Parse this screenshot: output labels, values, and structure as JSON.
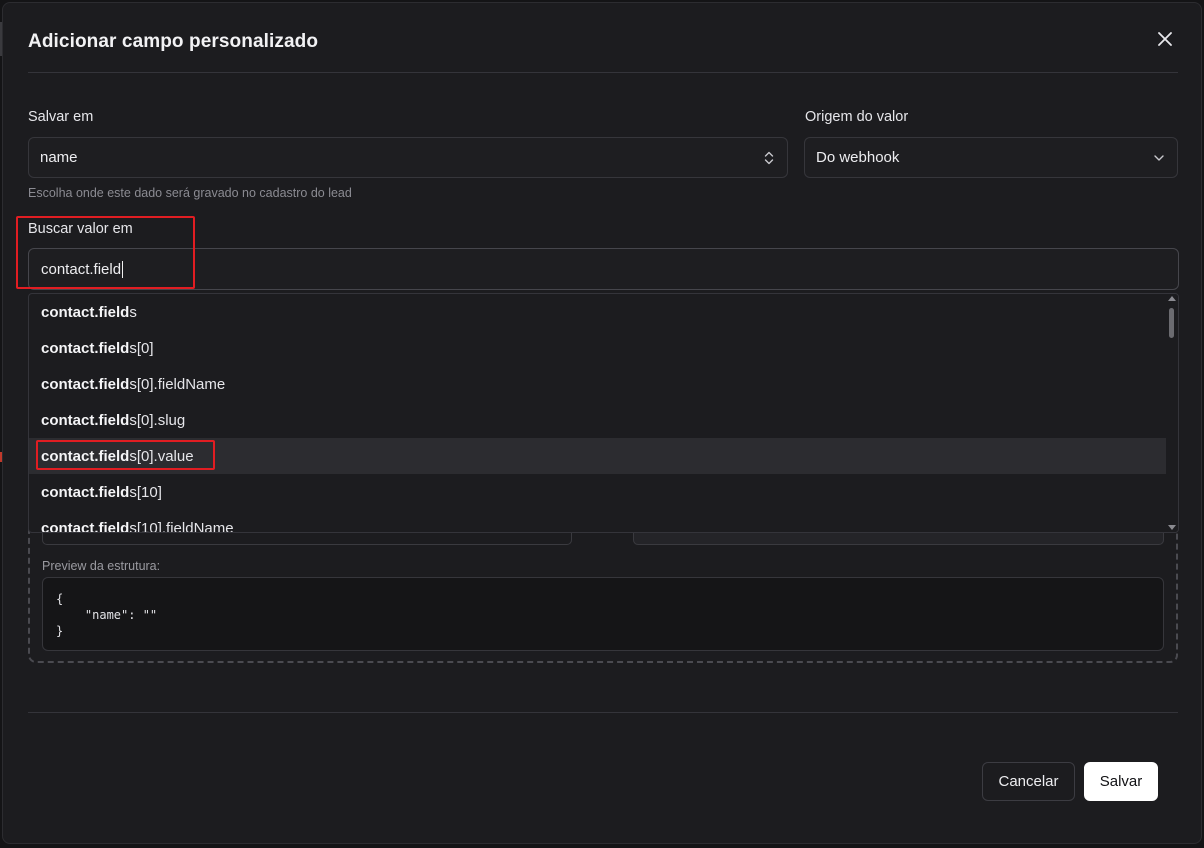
{
  "dialog": {
    "title": "Adicionar campo personalizado"
  },
  "form": {
    "save_in": {
      "label": "Salvar em",
      "value": "name",
      "hint": "Escolha onde este dado será gravado no cadastro do lead"
    },
    "value_origin": {
      "label": "Origem do valor",
      "value": "Do webhook"
    },
    "search_value": {
      "label": "Buscar valor em",
      "value": "contact.field"
    }
  },
  "suggestions": [
    {
      "match": "contact.field",
      "rest": "s",
      "active": false
    },
    {
      "match": "contact.field",
      "rest": "s[0]",
      "active": false
    },
    {
      "match": "contact.field",
      "rest": "s[0].fieldName",
      "active": false
    },
    {
      "match": "contact.field",
      "rest": "s[0].slug",
      "active": false
    },
    {
      "match": "contact.field",
      "rest": "s[0].value",
      "active": true
    },
    {
      "match": "contact.field",
      "rest": "s[10]",
      "active": false
    },
    {
      "match": "contact.field",
      "rest": "s[10].fieldName",
      "active": false
    }
  ],
  "preview": {
    "label": "Preview da estrutura:",
    "code": "{\n    \"name\": \"\"\n}"
  },
  "footer": {
    "cancel_label": "Cancelar",
    "save_label": "Salvar"
  },
  "colors": {
    "highlight": "#e11d22",
    "primary_button_bg": "#ffffff"
  }
}
